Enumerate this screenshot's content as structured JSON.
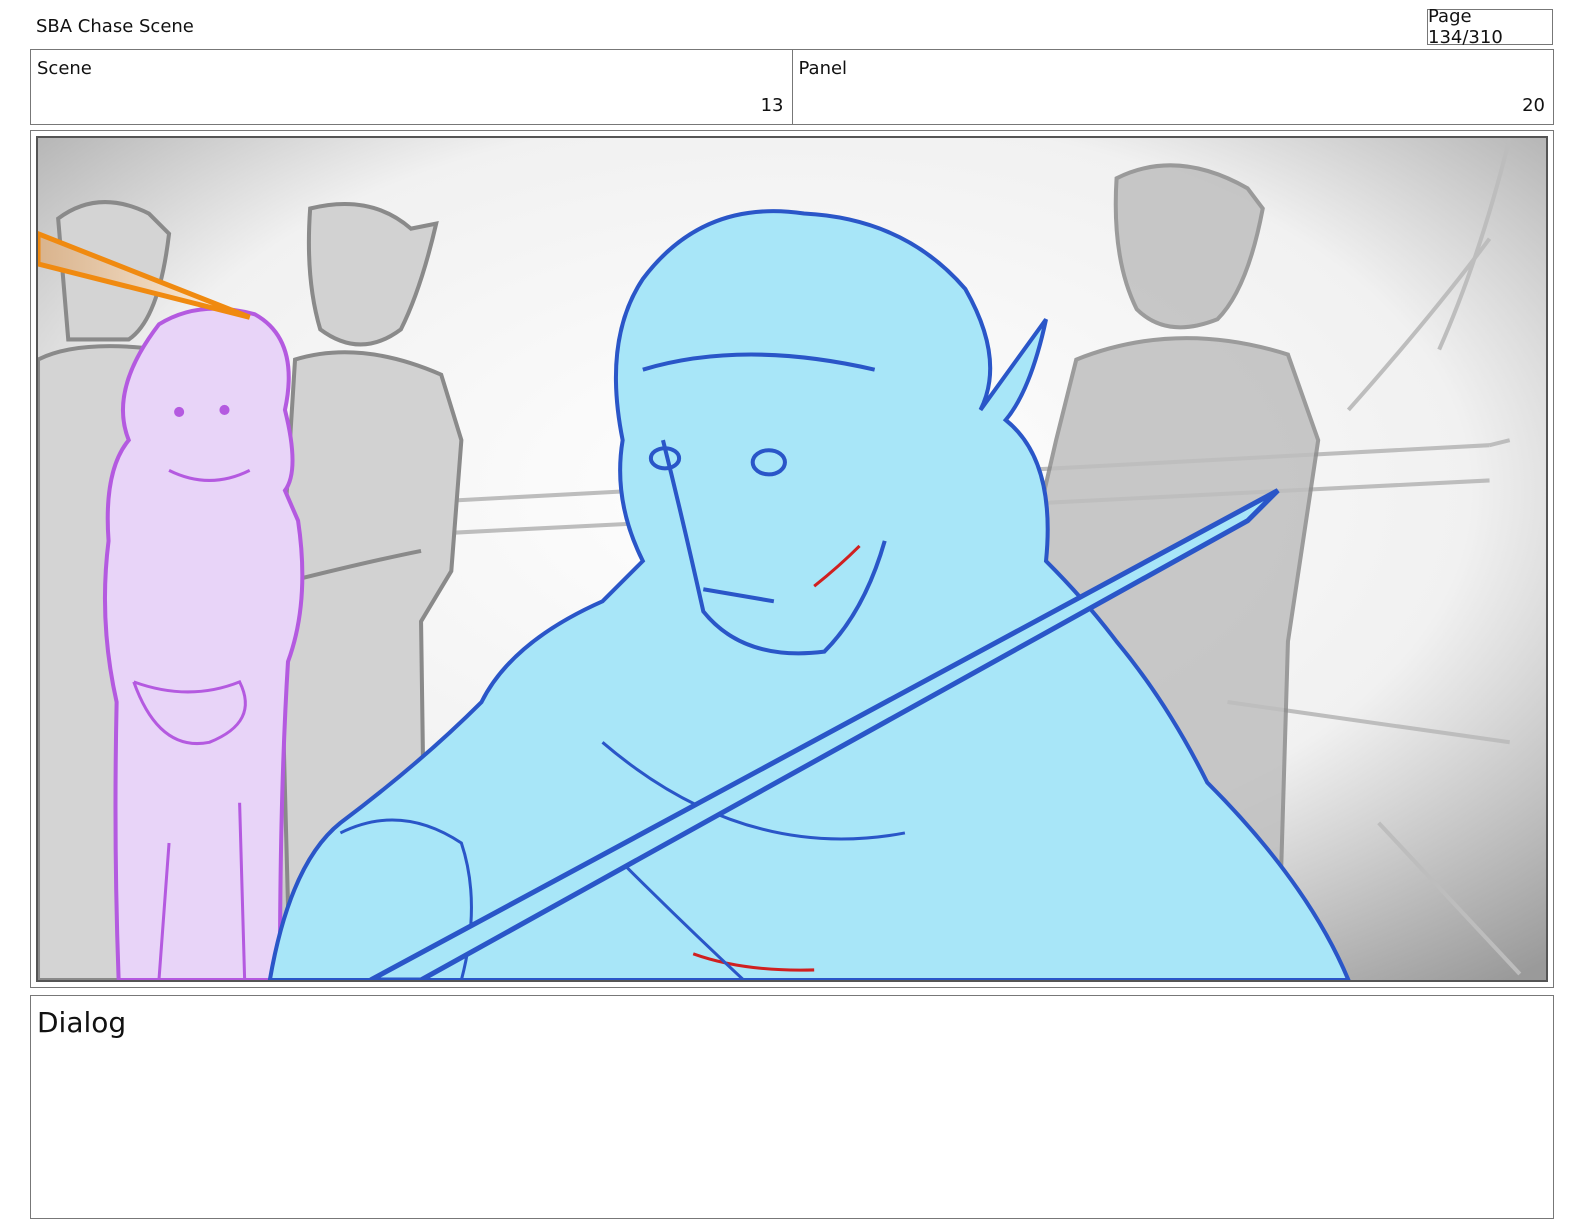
{
  "header": {
    "project_title": "SBA Chase Scene",
    "page_label": "Page 134/310"
  },
  "info": {
    "scene_label": "Scene",
    "scene_value": "13",
    "panel_label": "Panel",
    "panel_value": "20"
  },
  "dialog": {
    "label": "Dialog"
  },
  "colors": {
    "main_character_fill": "#a8e6f8",
    "main_character_line": "#2a56c8",
    "girl_fill": "#e8d4f8",
    "girl_line": "#b45ae0",
    "background_figures": "#8a8a8a",
    "arrow": "#f08a10"
  }
}
